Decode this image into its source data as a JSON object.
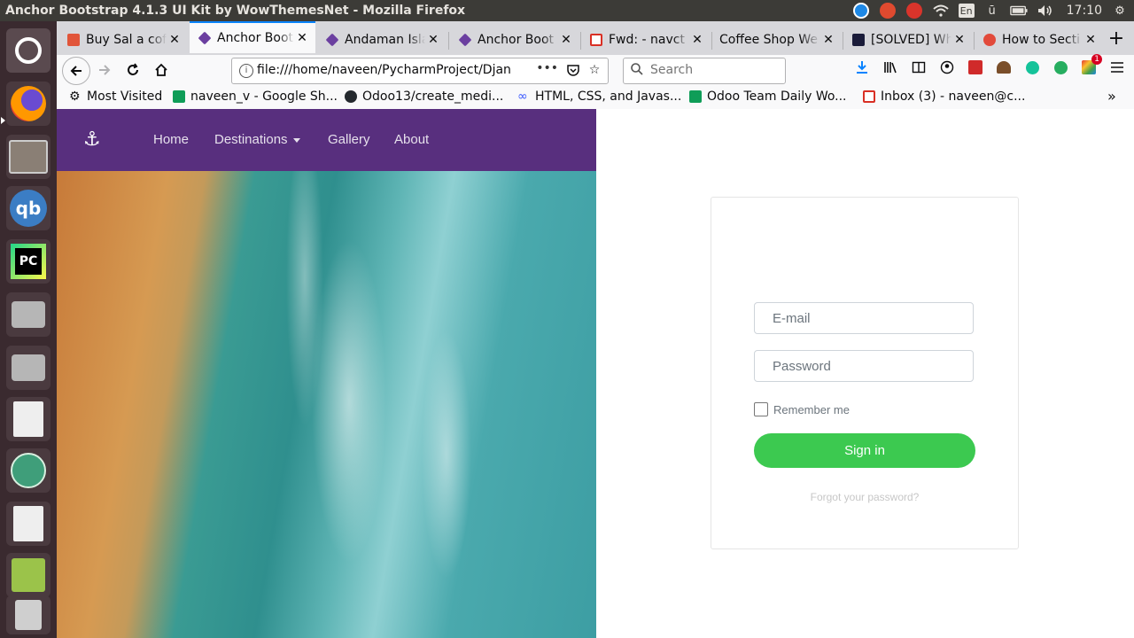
{
  "system": {
    "window_title": "Anchor Bootstrap 4.1.3 UI Kit by WowThemesNet - Mozilla Firefox",
    "keyboard_layout": "En",
    "clock": "17:10"
  },
  "browser": {
    "tabs": [
      {
        "title": "Buy Sal a cof",
        "favicon": "gift-icon",
        "color": "#e1553a"
      },
      {
        "title": "Anchor Boot",
        "favicon": "cube-icon",
        "color": "#6b3fa0"
      },
      {
        "title": "Andaman Isla",
        "favicon": "cube-icon",
        "color": "#6b3fa0"
      },
      {
        "title": "Anchor Boot",
        "favicon": "cube-icon",
        "color": "#6b3fa0"
      },
      {
        "title": "Fwd: - navct",
        "favicon": "gmail-icon",
        "color": "#d93025"
      },
      {
        "title": "Coffee Shop We",
        "favicon": "",
        "color": ""
      },
      {
        "title": "[SOLVED] Wh",
        "favicon": "angular-icon",
        "color": "#1b1c3a"
      },
      {
        "title": "How to Secti",
        "favicon": "flower-icon",
        "color": "#e24a3b"
      }
    ],
    "url": "file:///home/naveen/PycharmProject/Djan",
    "search_placeholder": "Search",
    "bookmarks": [
      {
        "label": "Most Visited",
        "icon": "gear-icon"
      },
      {
        "label": "naveen_v - Google Sh...",
        "icon": "sheets-icon"
      },
      {
        "label": "Odoo13/create_medi...",
        "icon": "github-icon"
      },
      {
        "label": "HTML, CSS, and Javas...",
        "icon": "link-icon"
      },
      {
        "label": "Odoo Team Daily Wo...",
        "icon": "sheets-icon"
      },
      {
        "label": "Inbox (3) - naveen@c...",
        "icon": "gmail-icon"
      }
    ],
    "notification_count": "1"
  },
  "page": {
    "nav": {
      "brand_icon": "anchor-icon",
      "links": [
        "Home",
        "Destinations",
        "Gallery",
        "About"
      ]
    },
    "login": {
      "email_placeholder": "E-mail",
      "password_placeholder": "Password",
      "remember_label": "Remember me",
      "signin_label": "Sign in",
      "forgot_label": "Forgot your password?"
    },
    "colors": {
      "nav_bg": "#582f7e",
      "signin_bg": "#3cc950"
    }
  }
}
